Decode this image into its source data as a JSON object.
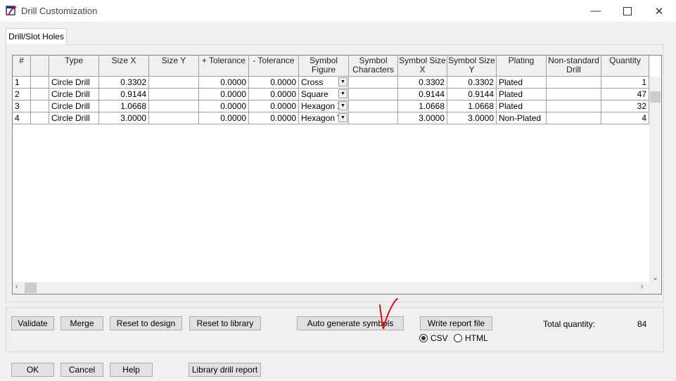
{
  "window": {
    "title": "Drill Customization"
  },
  "tabs": [
    {
      "label": "Drill/Slot Holes"
    }
  ],
  "table": {
    "columns": [
      "#",
      "",
      "Type",
      "Size X",
      "Size Y",
      "+ Tolerance",
      "- Tolerance",
      "Symbol Figure",
      "Symbol Characters",
      "Symbol Size X",
      "Symbol Size Y",
      "Plating",
      "Non-standard Drill",
      "Quantity"
    ],
    "rows": [
      [
        "1",
        "",
        "Circle Drill",
        "0.3302",
        "",
        "0.0000",
        "0.0000",
        "Cross",
        "",
        "0.3302",
        "0.3302",
        "Plated",
        "",
        "1"
      ],
      [
        "2",
        "",
        "Circle Drill",
        "0.9144",
        "",
        "0.0000",
        "0.0000",
        "Square",
        "",
        "0.9144",
        "0.9144",
        "Plated",
        "",
        "47"
      ],
      [
        "3",
        "",
        "Circle Drill",
        "1.0668",
        "",
        "0.0000",
        "0.0000",
        "Hexagon X",
        "",
        "1.0668",
        "1.0668",
        "Plated",
        "",
        "32"
      ],
      [
        "4",
        "",
        "Circle Drill",
        "3.0000",
        "",
        "0.0000",
        "0.0000",
        "Hexagon Y",
        "",
        "3.0000",
        "3.0000",
        "Non-Plated",
        "",
        "4"
      ]
    ]
  },
  "actions": {
    "validate": "Validate",
    "merge": "Merge",
    "reset_design": "Reset to design",
    "reset_library": "Reset to library",
    "auto_generate": "Auto generate symbols",
    "write_report": "Write report file",
    "csv": "CSV",
    "html": "HTML",
    "total_label": "Total quantity:",
    "total_value": "84"
  },
  "footer": {
    "ok": "OK",
    "cancel": "Cancel",
    "help": "Help",
    "library_report": "Library drill report"
  },
  "colors": {
    "annotation": "#e01010"
  },
  "icons": [
    "app-icon",
    "minimize-icon",
    "maximize-icon",
    "close-icon",
    "dropdown-arrow-icon",
    "scroll-up-icon",
    "scroll-down-icon",
    "scroll-left-icon",
    "scroll-right-icon"
  ]
}
